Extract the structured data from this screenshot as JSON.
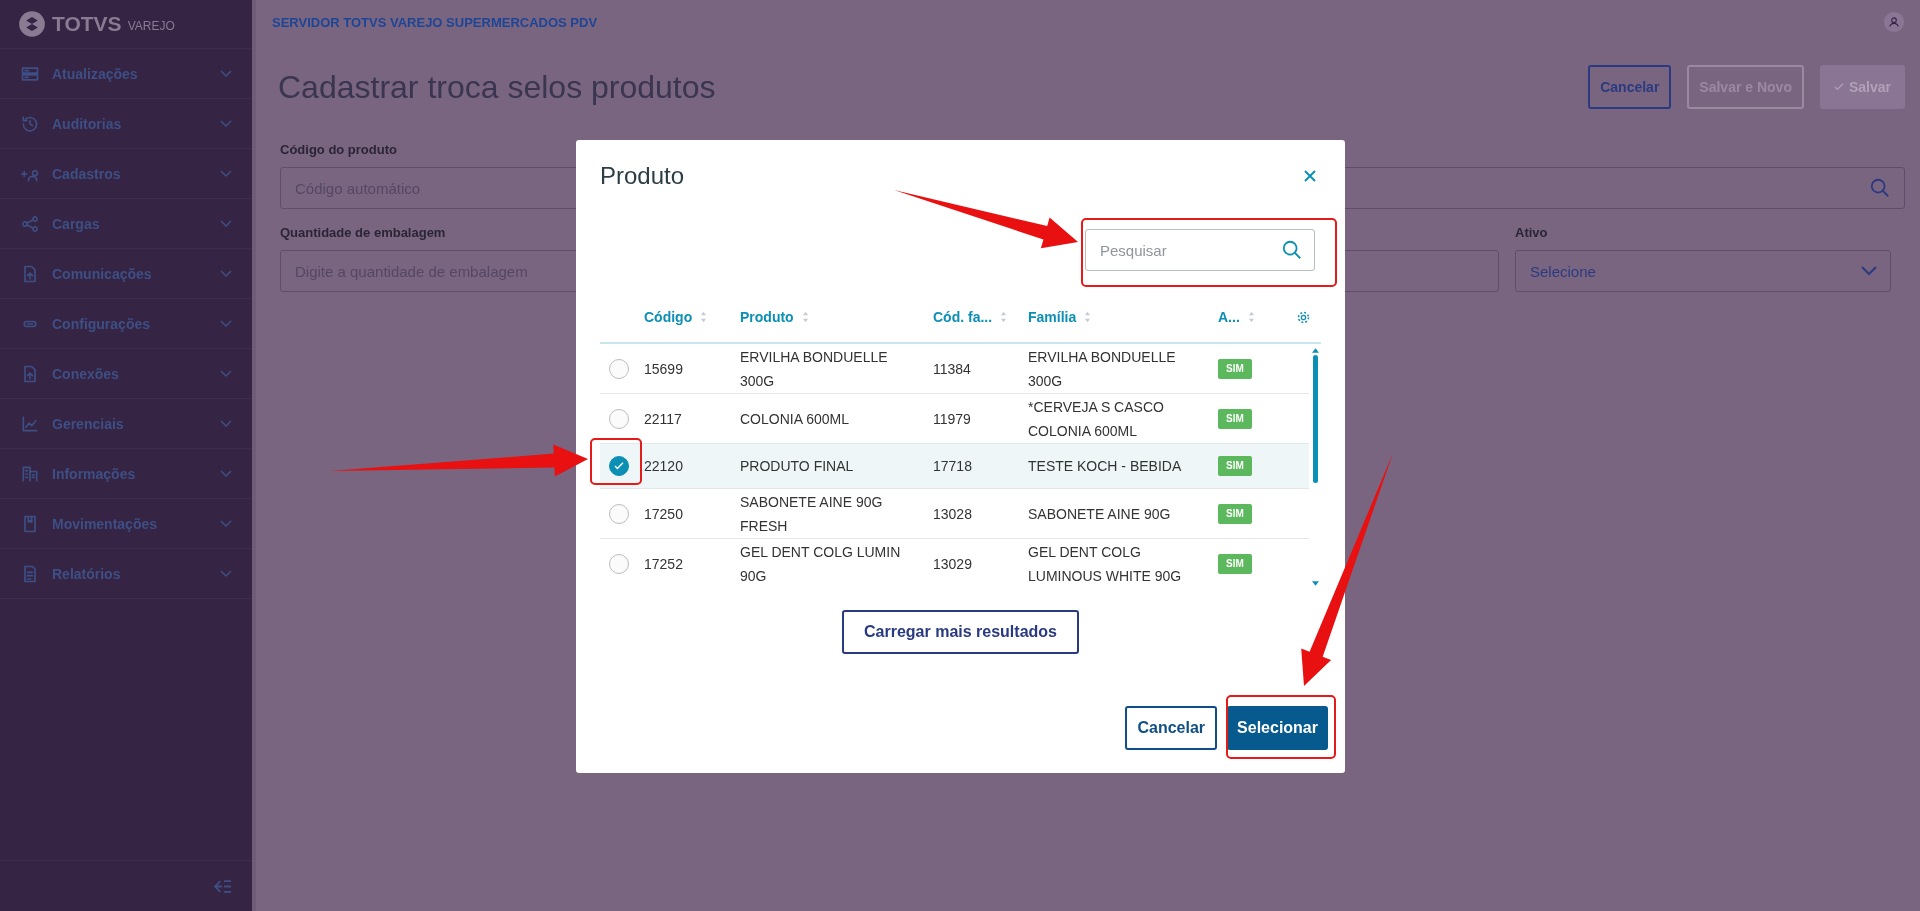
{
  "brand": {
    "name": "TOTVS",
    "product": "VAREJO"
  },
  "sidebar": {
    "items": [
      {
        "label": "Atualizações"
      },
      {
        "label": "Auditorias"
      },
      {
        "label": "Cadastros"
      },
      {
        "label": "Cargas"
      },
      {
        "label": "Comunicações"
      },
      {
        "label": "Configurações"
      },
      {
        "label": "Conexões"
      },
      {
        "label": "Gerenciais"
      },
      {
        "label": "Informações"
      },
      {
        "label": "Movimentações"
      },
      {
        "label": "Relatórios"
      }
    ]
  },
  "header": {
    "title": "SERVIDOR TOTVS VAREJO SUPERMERCADOS PDV"
  },
  "page": {
    "title": "Cadastrar troca selos produtos",
    "actions": [
      {
        "label": "Cancelar",
        "kind": "outline"
      },
      {
        "label": "Salvar e Novo",
        "kind": "disabled"
      },
      {
        "label": "Salvar",
        "kind": "primary"
      }
    ],
    "form_rows": [
      [
        {
          "label": "Código do produto",
          "placeholder": "Código automático",
          "kind": "search"
        }
      ],
      [
        {
          "label": "Quantidade de embalagem",
          "placeholder": "Digite a quantidade de embalagem",
          "kind": "text"
        },
        {
          "label": "Ativo",
          "placeholder": "Selecione",
          "kind": "select"
        }
      ]
    ]
  },
  "modal": {
    "title": "Produto",
    "search": {
      "placeholder": "Pesquisar"
    },
    "columns": [
      "Código",
      "Produto",
      "Cód. fa...",
      "Família",
      "A..."
    ],
    "rows": [
      {
        "code": "15699",
        "product": "ERVILHA BONDUELLE 300G",
        "family_code": "11384",
        "family": "ERVILHA BONDUELLE 300G",
        "active": "SIM",
        "selected": false
      },
      {
        "code": "22117",
        "product": "COLONIA 600ML",
        "family_code": "11979",
        "family": "*CERVEJA S CASCO COLONIA 600ML",
        "active": "SIM",
        "selected": false
      },
      {
        "code": "22120",
        "product": "PRODUTO FINAL",
        "family_code": "17718",
        "family": "TESTE KOCH - BEBIDA",
        "active": "SIM",
        "selected": true
      },
      {
        "code": "17250",
        "product": "SABONETE AINE 90G FRESH",
        "family_code": "13028",
        "family": "SABONETE AINE 90G",
        "active": "SIM",
        "selected": false
      },
      {
        "code": "17252",
        "product": "GEL DENT COLG LUMIN 90G",
        "family_code": "13029",
        "family": "GEL DENT COLG LUMINOUS WHITE 90G",
        "active": "SIM",
        "selected": false
      }
    ],
    "load_more": "Carregar mais resultados",
    "buttons": [
      {
        "label": "Cancelar",
        "kind": "outline"
      },
      {
        "label": "Selecionar",
        "kind": "primary"
      }
    ]
  }
}
